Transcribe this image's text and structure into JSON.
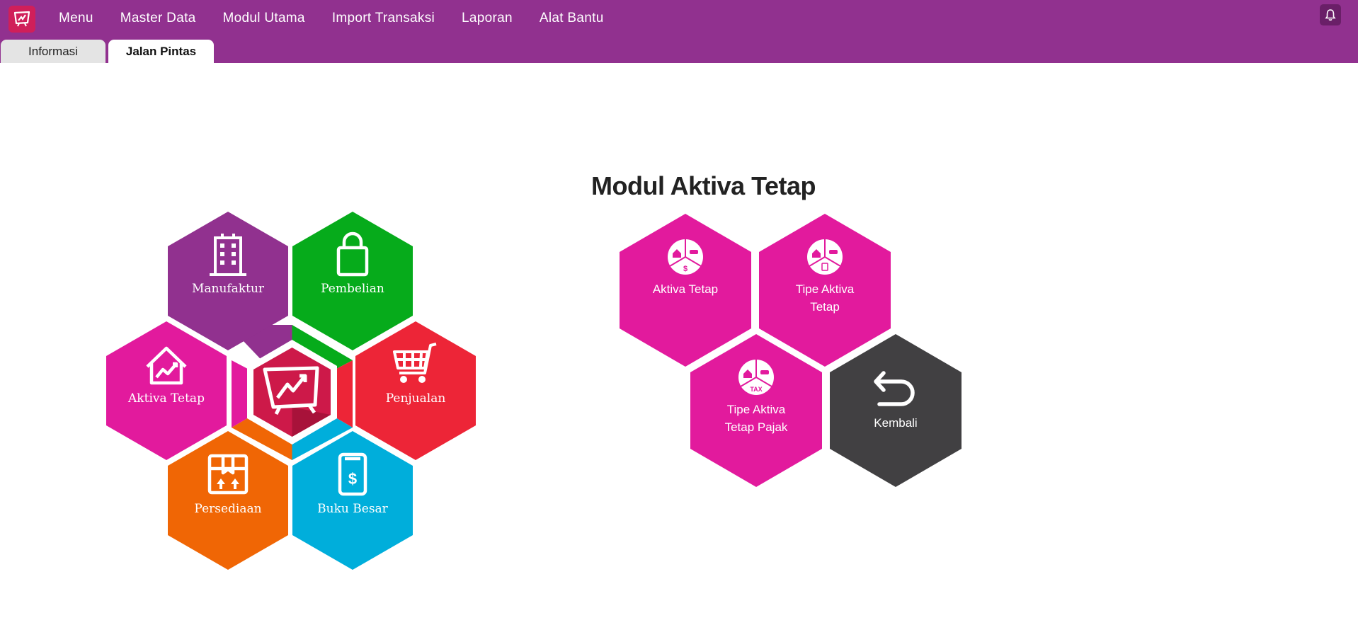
{
  "menu": {
    "items": [
      "Menu",
      "Master Data",
      "Modul Utama",
      "Import Transaksi",
      "Laporan",
      "Alat Bantu"
    ]
  },
  "tabs": {
    "informasi": "Informasi",
    "jalan_pintas": "Jalan Pintas"
  },
  "colors": {
    "topbar": "#91318f",
    "manufaktur": "#91318f",
    "pembelian": "#06ab1b",
    "penjualan": "#ed2537",
    "buku_besar": "#00aedb",
    "persediaan": "#f06605",
    "aktiva_tetap": "#e21a9d",
    "center": "#cd1949",
    "kembali": "#414042"
  },
  "left_cluster": {
    "manufaktur": "Manufaktur",
    "pembelian": "Pembelian",
    "aktiva_tetap": "Aktiva Tetap",
    "penjualan": "Penjualan",
    "persediaan": "Persediaan",
    "buku_besar": "Buku Besar"
  },
  "module": {
    "title": "Modul Aktiva Tetap",
    "aktiva_tetap": "Aktiva Tetap",
    "tipe_aktiva_tetap_1": "Tipe Aktiva",
    "tipe_aktiva_tetap_2": "Tetap",
    "tipe_pajak_1": "Tipe Aktiva",
    "tipe_pajak_2": "Tetap Pajak",
    "kembali": "Kembali",
    "tax_badge": "TAX"
  }
}
